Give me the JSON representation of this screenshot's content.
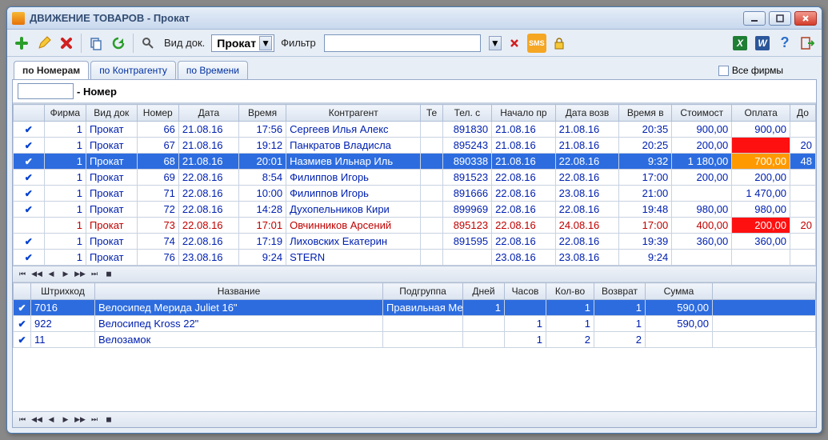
{
  "title": "ДВИЖЕНИЕ ТОВАРОВ - Прокат",
  "toolbar": {
    "doc_type_label": "Вид док.",
    "doc_type_value": "Прокат",
    "filter_label": "Фильтр"
  },
  "tabs": {
    "t1": "по Номерам",
    "t2": "по Контрагенту",
    "t3": "по Времени",
    "all_firms": "Все фирмы"
  },
  "num_label": "- Номер",
  "cols": {
    "c0": "",
    "firma": "Фирма",
    "vdok": "Вид док",
    "nomer": "Номер",
    "data": "Дата",
    "vremya": "Время",
    "kontr": "Контрагент",
    "te": "Те",
    "tels": "Тел. с",
    "nach": "Начало пр",
    "dvozv": "Дата возв",
    "vvozv": "Время в",
    "stoim": "Стоимост",
    "opl": "Оплата",
    "dol": "До"
  },
  "rows": [
    {
      "chk": "✔",
      "firma": "1",
      "vdok": "Прокат",
      "nomer": "66",
      "data": "21.08.16",
      "vremya": "17:56",
      "kontr": "Сергеев Илья Алекс",
      "te": "",
      "tels": "891830",
      "nach": "21.08.16",
      "dvoz": "21.08.16",
      "vvoz": "20:35",
      "stoim": "900,00",
      "opl": "900,00",
      "dol": ""
    },
    {
      "chk": "✔",
      "firma": "1",
      "vdok": "Прокат",
      "nomer": "67",
      "data": "21.08.16",
      "vremya": "19:12",
      "kontr": "Панкратов Владисла",
      "te": "",
      "tels": "895243",
      "nach": "21.08.16",
      "dvoz": "21.08.16",
      "vvoz": "20:25",
      "stoim": "200,00",
      "opl": "",
      "dol": "20",
      "oplred": true
    },
    {
      "chk": "✔",
      "firma": "1",
      "vdok": "Прокат",
      "nomer": "68",
      "data": "21.08.16",
      "vremya": "20:01",
      "kontr": "Назмиев Ильнар Иль",
      "te": "",
      "tels": "890338",
      "nach": "21.08.16",
      "dvoz": "22.08.16",
      "vvoz": "9:32",
      "stoim": "1 180,00",
      "opl": "700,00",
      "dol": "48",
      "sel": true
    },
    {
      "chk": "✔",
      "firma": "1",
      "vdok": "Прокат",
      "nomer": "69",
      "data": "22.08.16",
      "vremya": "8:54",
      "kontr": "Филиппов Игорь",
      "te": "",
      "tels": "891523",
      "nach": "22.08.16",
      "dvoz": "22.08.16",
      "vvoz": "17:00",
      "stoim": "200,00",
      "opl": "200,00",
      "dol": ""
    },
    {
      "chk": "✔",
      "firma": "1",
      "vdok": "Прокат",
      "nomer": "71",
      "data": "22.08.16",
      "vremya": "10:00",
      "kontr": "Филиппов Игорь",
      "te": "",
      "tels": "891666",
      "nach": "22.08.16",
      "dvoz": "23.08.16",
      "vvoz": "21:00",
      "stoim": "",
      "opl": "1 470,00",
      "dol": ""
    },
    {
      "chk": "✔",
      "firma": "1",
      "vdok": "Прокат",
      "nomer": "72",
      "data": "22.08.16",
      "vremya": "14:28",
      "kontr": "Духопельников Кири",
      "te": "",
      "tels": "899969",
      "nach": "22.08.16",
      "dvoz": "22.08.16",
      "vvoz": "19:48",
      "stoim": "980,00",
      "opl": "980,00",
      "dol": ""
    },
    {
      "chk": "",
      "firma": "1",
      "vdok": "Прокат",
      "nomer": "73",
      "data": "22.08.16",
      "vremya": "17:01",
      "kontr": "Овчинников Арсений",
      "te": "",
      "tels": "895123",
      "nach": "22.08.16",
      "dvoz": "24.08.16",
      "vvoz": "17:00",
      "stoim": "400,00",
      "opl": "200,00",
      "dol": "20",
      "red": true,
      "oplred": true
    },
    {
      "chk": "✔",
      "firma": "1",
      "vdok": "Прокат",
      "nomer": "74",
      "data": "22.08.16",
      "vremya": "17:19",
      "kontr": "Лиховских Екатерин",
      "te": "",
      "tels": "891595",
      "nach": "22.08.16",
      "dvoz": "22.08.16",
      "vvoz": "19:39",
      "stoim": "360,00",
      "opl": "360,00",
      "dol": ""
    },
    {
      "chk": "✔",
      "firma": "1",
      "vdok": "Прокат",
      "nomer": "76",
      "data": "23.08.16",
      "vremya": "9:24",
      "kontr": "STERN",
      "te": "",
      "tels": "",
      "nach": "23.08.16",
      "dvoz": "23.08.16",
      "vvoz": "9:24",
      "stoim": "",
      "opl": "",
      "dol": ""
    }
  ],
  "cols2": {
    "c0": "",
    "bar": "Штрихкод",
    "name": "Название",
    "sub": "Подгруппа",
    "days": "Дней",
    "hours": "Часов",
    "qty": "Кол-во",
    "ret": "Возврат",
    "sum": "Сумма",
    "e": ""
  },
  "rows2": [
    {
      "chk": "✔",
      "bar": "7016",
      "name": "Велосипед Мерида Juliet 16\"",
      "sub": "Правильная Ме",
      "days": "1",
      "hours": "",
      "qty": "1",
      "ret": "1",
      "sum": "590,00",
      "sel": true
    },
    {
      "chk": "✔",
      "bar": "922",
      "name": "Велосипед Kross 22\"",
      "sub": "",
      "days": "",
      "hours": "1",
      "qty": "1",
      "ret": "1",
      "sum": "590,00"
    },
    {
      "chk": "✔",
      "bar": "11",
      "name": "Велозамок",
      "sub": "",
      "days": "",
      "hours": "1",
      "qty": "2",
      "ret": "2",
      "sum": ""
    }
  ]
}
